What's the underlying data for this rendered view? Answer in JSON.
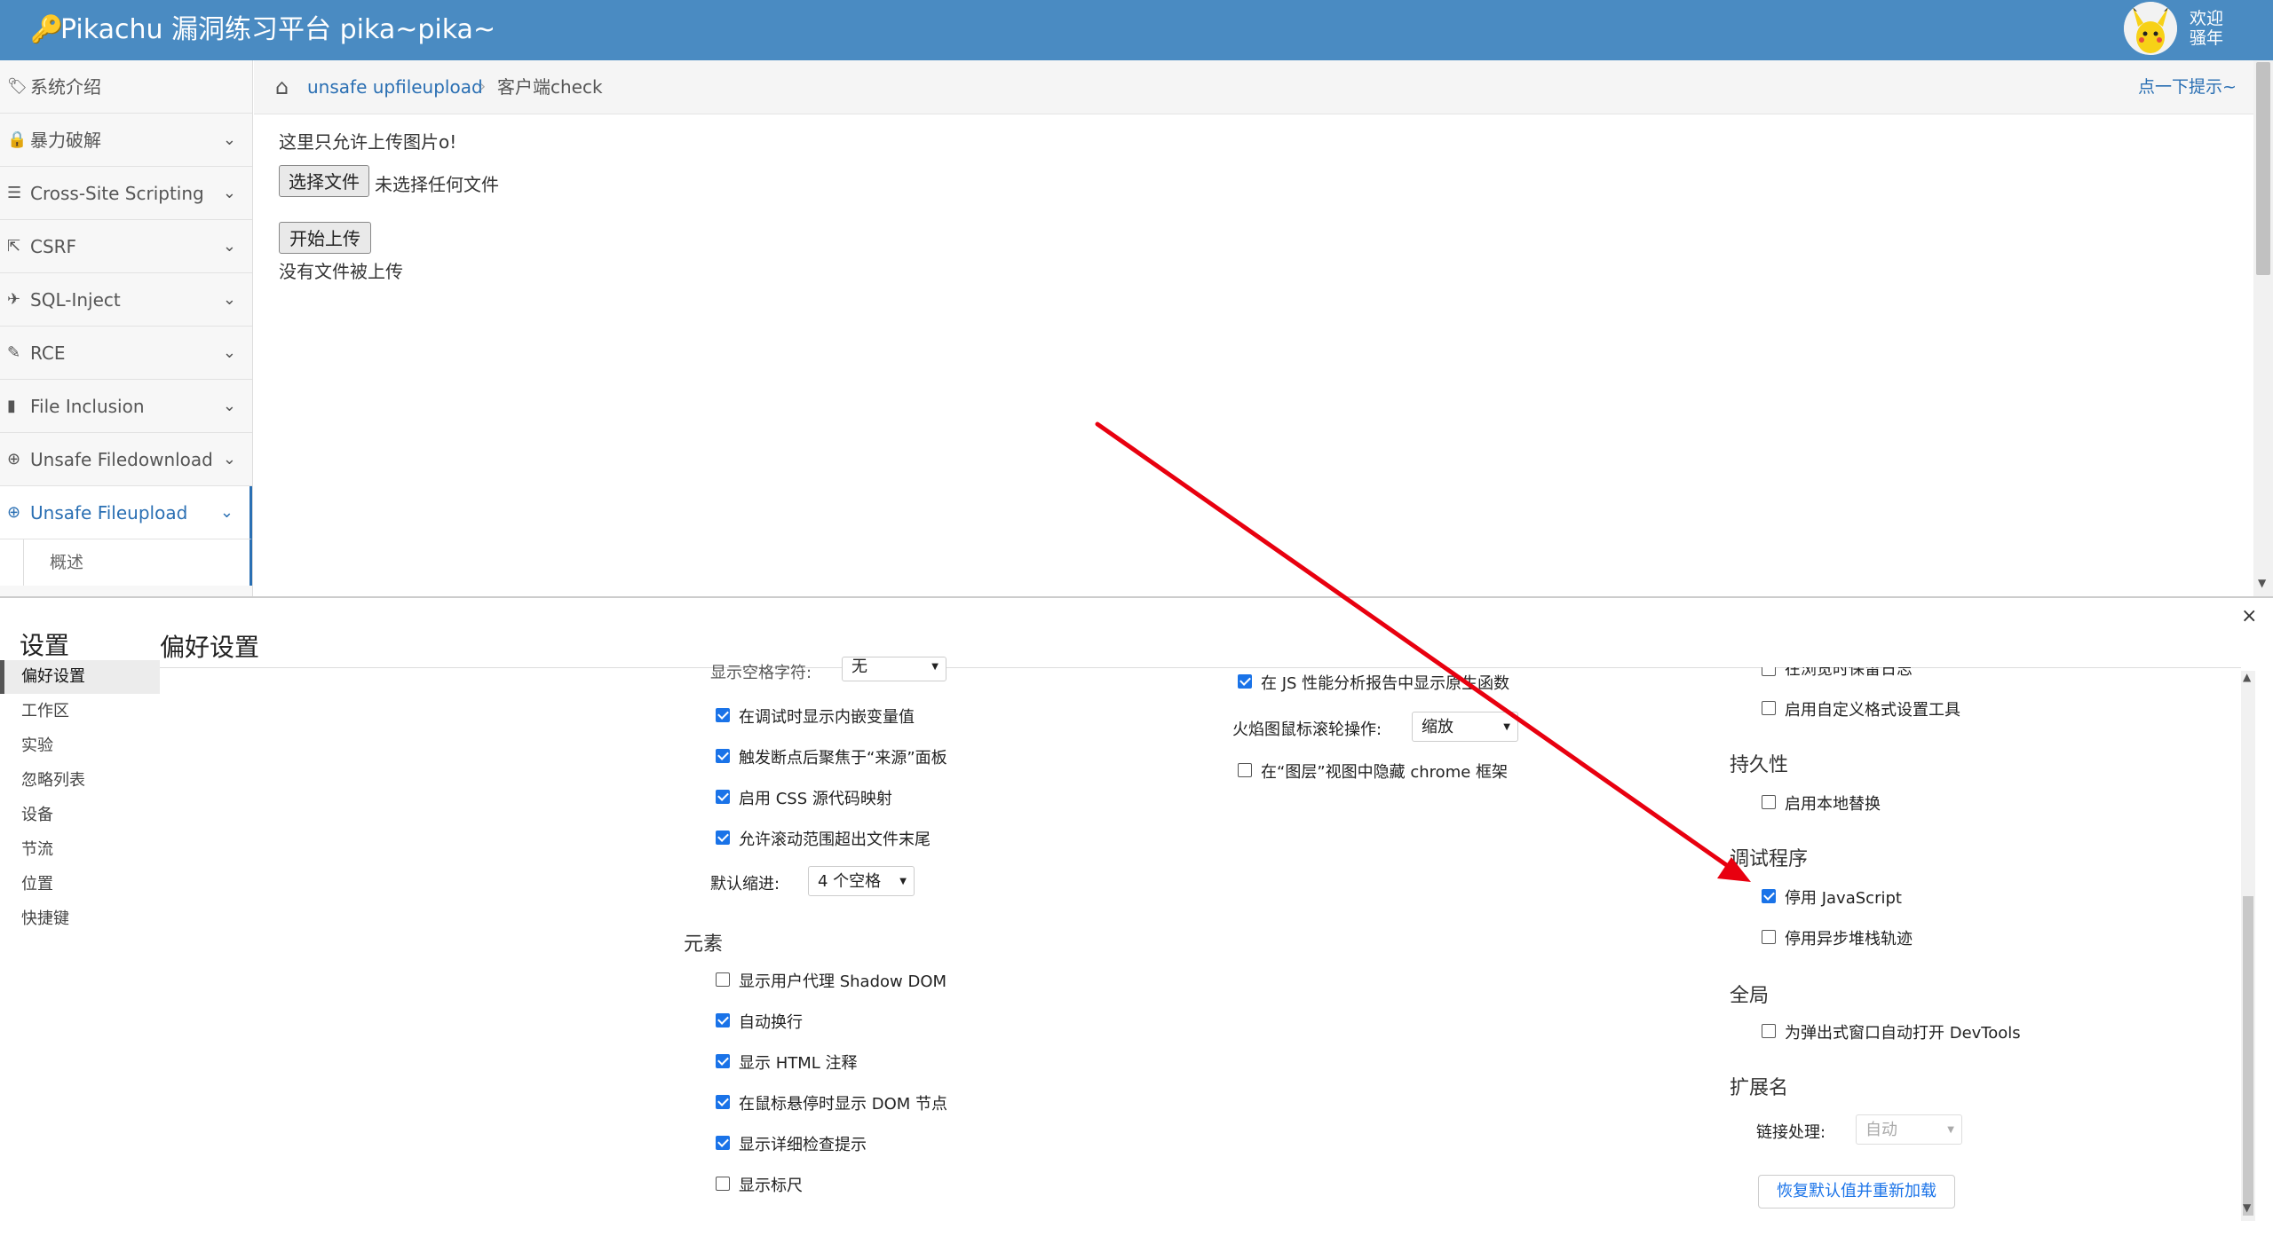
{
  "app": {
    "title": "Pikachu 漏洞练习平台 pika~pika~",
    "welcome": [
      "欢迎",
      "骚年"
    ]
  },
  "sidebar": {
    "items": [
      {
        "label": "系统介绍",
        "icon": "tag-icon",
        "glyph": "🏷"
      },
      {
        "label": "暴力破解",
        "icon": "lock-icon",
        "glyph": "🔒"
      },
      {
        "label": "Cross-Site Scripting",
        "icon": "list-icon",
        "glyph": "☰"
      },
      {
        "label": "CSRF",
        "icon": "share-icon",
        "glyph": "⇱"
      },
      {
        "label": "SQL-Inject",
        "icon": "plane-icon",
        "glyph": "✈"
      },
      {
        "label": "RCE",
        "icon": "pencil-icon",
        "glyph": "✎"
      },
      {
        "label": "File Inclusion",
        "icon": "file-icon",
        "glyph": "▮"
      },
      {
        "label": "Unsafe Filedownload",
        "icon": "download-icon",
        "glyph": "⊕"
      },
      {
        "label": "Unsafe Fileupload",
        "icon": "upload-icon",
        "glyph": "⊕"
      }
    ],
    "sub_items": [
      {
        "label": "概述"
      }
    ],
    "active": "Unsafe Fileupload"
  },
  "breadcrumb": {
    "link": "unsafe upfileupload",
    "current": "客户端check",
    "hint": "点一下提示~"
  },
  "main": {
    "intro": "这里只允许上传图片o!",
    "choose_file": "选择文件",
    "no_file_chosen": "未选择任何文件",
    "upload_button": "开始上传",
    "status": "没有文件被上传"
  },
  "devtools": {
    "title": "设置",
    "page_title": "偏好设置",
    "close": "×",
    "nav": [
      "偏好设置",
      "工作区",
      "实验",
      "忽略列表",
      "设备",
      "节流",
      "位置",
      "快捷键"
    ],
    "selected_nav": "偏好设置",
    "col1": {
      "partial_label": "显示空格字符:",
      "partial_select": "无",
      "checkboxes": [
        {
          "label": "在调试时显示内嵌变量值",
          "checked": true
        },
        {
          "label": "触发断点后聚焦于“来源”面板",
          "checked": true
        },
        {
          "label": "启用 CSS 源代码映射",
          "checked": true
        },
        {
          "label": "允许滚动范围超出文件末尾",
          "checked": true
        }
      ],
      "indent_label": "默认缩进:",
      "indent_value": "4 个空格",
      "elements_section": "元素",
      "elements": [
        {
          "label": "显示用户代理 Shadow DOM",
          "checked": false
        },
        {
          "label": "自动换行",
          "checked": true
        },
        {
          "label": "显示 HTML 注释",
          "checked": true
        },
        {
          "label": "在鼠标悬停时显示 DOM 节点",
          "checked": true
        },
        {
          "label": "显示详细检查提示",
          "checked": true
        },
        {
          "label": "显示标尺",
          "checked": false
        }
      ]
    },
    "col2": {
      "cb1": {
        "label": "在 JS 性能分析报告中显示原生函数",
        "checked": true
      },
      "flame_label": "火焰图鼠标滚轮操作:",
      "flame_value": "缩放",
      "cb2": {
        "label": "在“图层”视图中隐藏 chrome 框架",
        "checked": false
      }
    },
    "col3": {
      "partial_label": "在浏览时保留日志",
      "custom_fmt": {
        "label": "启用自定义格式设置工具",
        "checked": false
      },
      "persistence_section": "持久性",
      "local_override": {
        "label": "启用本地替换",
        "checked": false
      },
      "debugger_section": "调试程序",
      "disable_js": {
        "label": "停用 JavaScript",
        "checked": true
      },
      "disable_async": {
        "label": "停用异步堆栈轨迹",
        "checked": false
      },
      "global_section": "全局",
      "auto_open": {
        "label": "为弹出式窗口自动打开 DevTools",
        "checked": false
      },
      "extension_section": "扩展名",
      "link_label": "链接处理:",
      "link_value": "自动",
      "reset_button": "恢复默认值并重新加载"
    }
  },
  "annotation": {
    "color": "#e8000f"
  }
}
